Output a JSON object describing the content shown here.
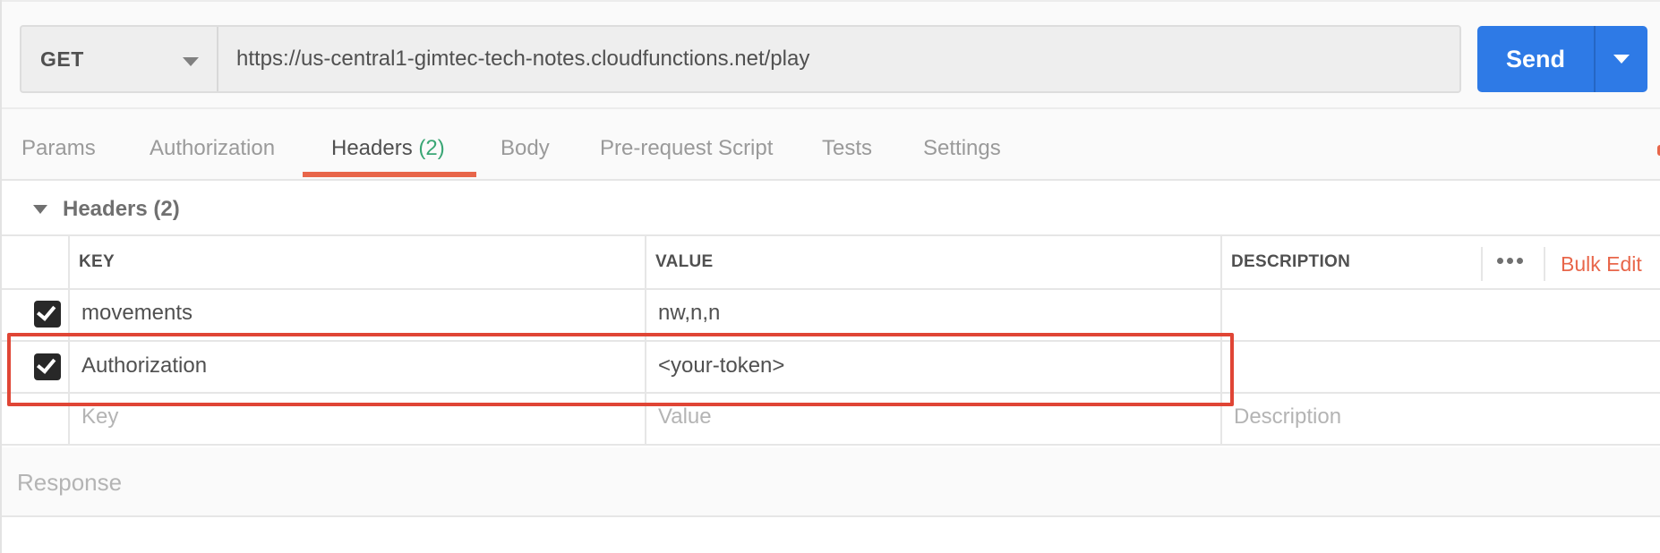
{
  "request": {
    "method": "GET",
    "url": "https://us-central1-gimtec-tech-notes.cloudfunctions.net/play",
    "send_label": "Send"
  },
  "tabs": [
    {
      "label": "Params"
    },
    {
      "label": "Authorization"
    },
    {
      "label": "Headers",
      "count": "(2)",
      "active": true
    },
    {
      "label": "Body"
    },
    {
      "label": "Pre-request Script"
    },
    {
      "label": "Tests"
    },
    {
      "label": "Settings"
    }
  ],
  "headers_section": {
    "title": "Headers",
    "count": "(2)",
    "columns": {
      "key": "KEY",
      "value": "VALUE",
      "description": "DESCRIPTION"
    },
    "bulk_edit_label": "Bulk Edit",
    "rows": [
      {
        "checked": true,
        "key": "movements",
        "value": "nw,n,n",
        "description": ""
      },
      {
        "checked": true,
        "key": "Authorization",
        "value": "<your-token>",
        "description": ""
      }
    ],
    "new_row_placeholders": {
      "key": "Key",
      "value": "Value",
      "description": "Description"
    }
  },
  "response": {
    "title": "Response"
  },
  "colors": {
    "accent_orange": "#e8664a",
    "send_blue": "#2e7ae6",
    "count_green": "#3aa675",
    "highlight_red": "#e04535"
  }
}
